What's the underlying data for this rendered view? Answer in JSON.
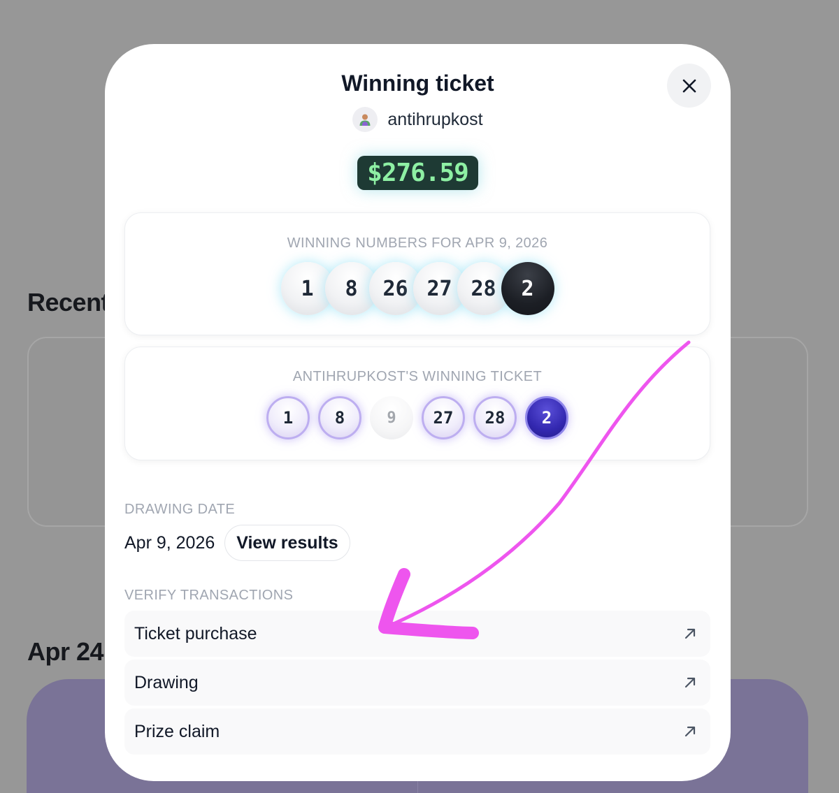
{
  "background": {
    "heading_recent": "Recent",
    "heading_date": "Apr 24"
  },
  "modal": {
    "title": "Winning ticket",
    "username": "antihrupkost",
    "prize": "$276.59",
    "winning_numbers": {
      "label": "WINNING NUMBERS FOR APR 9, 2026",
      "balls": [
        "1",
        "8",
        "26",
        "27",
        "28"
      ],
      "power_ball": "2"
    },
    "ticket": {
      "label": "ANTIHRUPKOST'S WINNING TICKET",
      "balls": [
        {
          "value": "1",
          "matched": true
        },
        {
          "value": "8",
          "matched": true
        },
        {
          "value": "9",
          "matched": false
        },
        {
          "value": "27",
          "matched": true
        },
        {
          "value": "28",
          "matched": true
        }
      ],
      "power_ball": "2"
    },
    "drawing_date": {
      "label": "DRAWING DATE",
      "value": "Apr 9, 2026",
      "view_results": "View results"
    },
    "verify": {
      "label": "VERIFY TRANSACTIONS",
      "items": [
        "Ticket purchase",
        "Drawing",
        "Prize claim"
      ]
    }
  },
  "icons": {
    "close": "close-icon",
    "external": "arrow-up-right-icon",
    "avatar": "user-avatar-icon"
  },
  "colors": {
    "prize_bg": "#1e3a34",
    "prize_text": "#8ef0a4",
    "annotation": "#ee55ee",
    "power_ball_dark": "#1c1f25",
    "power_ball_purple": "#3328b0"
  }
}
